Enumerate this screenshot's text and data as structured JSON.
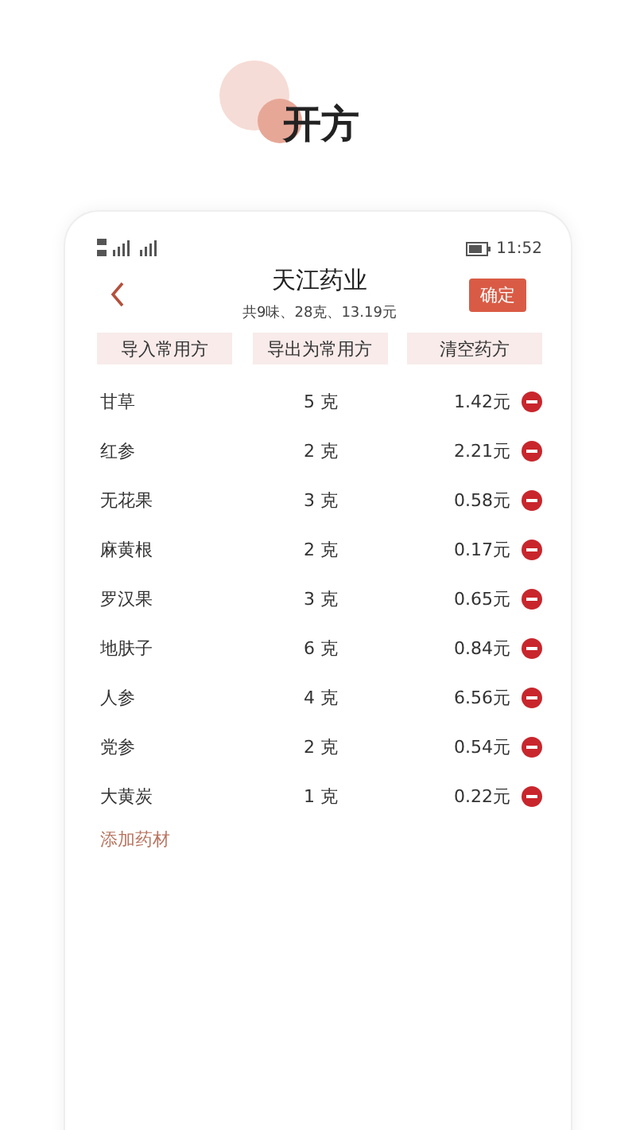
{
  "headline": "开方",
  "status_bar": {
    "time": "11:52"
  },
  "header": {
    "title": "天江药业",
    "summary": "共9味、28克、13.19元",
    "confirm": "确定"
  },
  "actions": [
    "导入常用方",
    "导出为常用方",
    "清空药方"
  ],
  "herbs": [
    {
      "name": "甘草",
      "amount": "5 克",
      "price": "1.42元"
    },
    {
      "name": "红参",
      "amount": "2 克",
      "price": "2.21元"
    },
    {
      "name": "无花果",
      "amount": "3 克",
      "price": "0.58元"
    },
    {
      "name": "麻黄根",
      "amount": "2 克",
      "price": "0.17元"
    },
    {
      "name": "罗汉果",
      "amount": "3 克",
      "price": "0.65元"
    },
    {
      "name": "地肤子",
      "amount": "6 克",
      "price": "0.84元"
    },
    {
      "name": "人参",
      "amount": "4 克",
      "price": "6.56元"
    },
    {
      "name": "党参",
      "amount": "2 克",
      "price": "0.54元"
    },
    {
      "name": "大黄炭",
      "amount": "1 克",
      "price": "0.22元"
    }
  ],
  "add_link": "添加药材"
}
